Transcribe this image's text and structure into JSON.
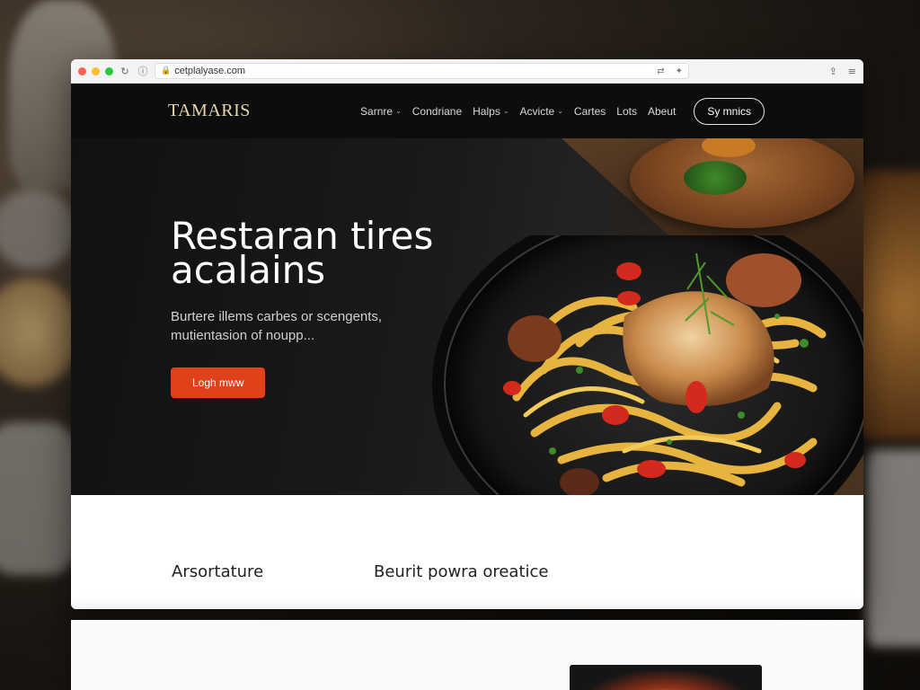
{
  "browser": {
    "url": "cetplalyase.com"
  },
  "site": {
    "logo": "TAMARIS",
    "nav": [
      {
        "label": "Sarnre",
        "dropdown": true
      },
      {
        "label": "Condriane",
        "dropdown": false
      },
      {
        "label": "Halps",
        "dropdown": true
      },
      {
        "label": "Acvicte",
        "dropdown": true
      },
      {
        "label": "Cartes",
        "dropdown": false
      },
      {
        "label": "Lots",
        "dropdown": false
      },
      {
        "label": "Abeut",
        "dropdown": false
      }
    ],
    "cta": "Sy mnics"
  },
  "hero": {
    "title_line1": "Restaran tires",
    "title_line2": "acalains",
    "subtitle_line1": "Burtere illems carbes or scengents,",
    "subtitle_line2": "mutientasion of noupp...",
    "button": "Logh mww"
  },
  "features": {
    "item1": "Arsortature",
    "item2": "Beurit powra oreatice"
  },
  "icons": {
    "chrome_reload": "reload-icon",
    "chrome_info": "info-icon",
    "lock": "lock-icon",
    "share": "share-icon",
    "menu": "menu-icon"
  },
  "colors": {
    "accent": "#e0401a",
    "header_bg": "#0d0d0e",
    "logo": "#e8d6b0"
  }
}
